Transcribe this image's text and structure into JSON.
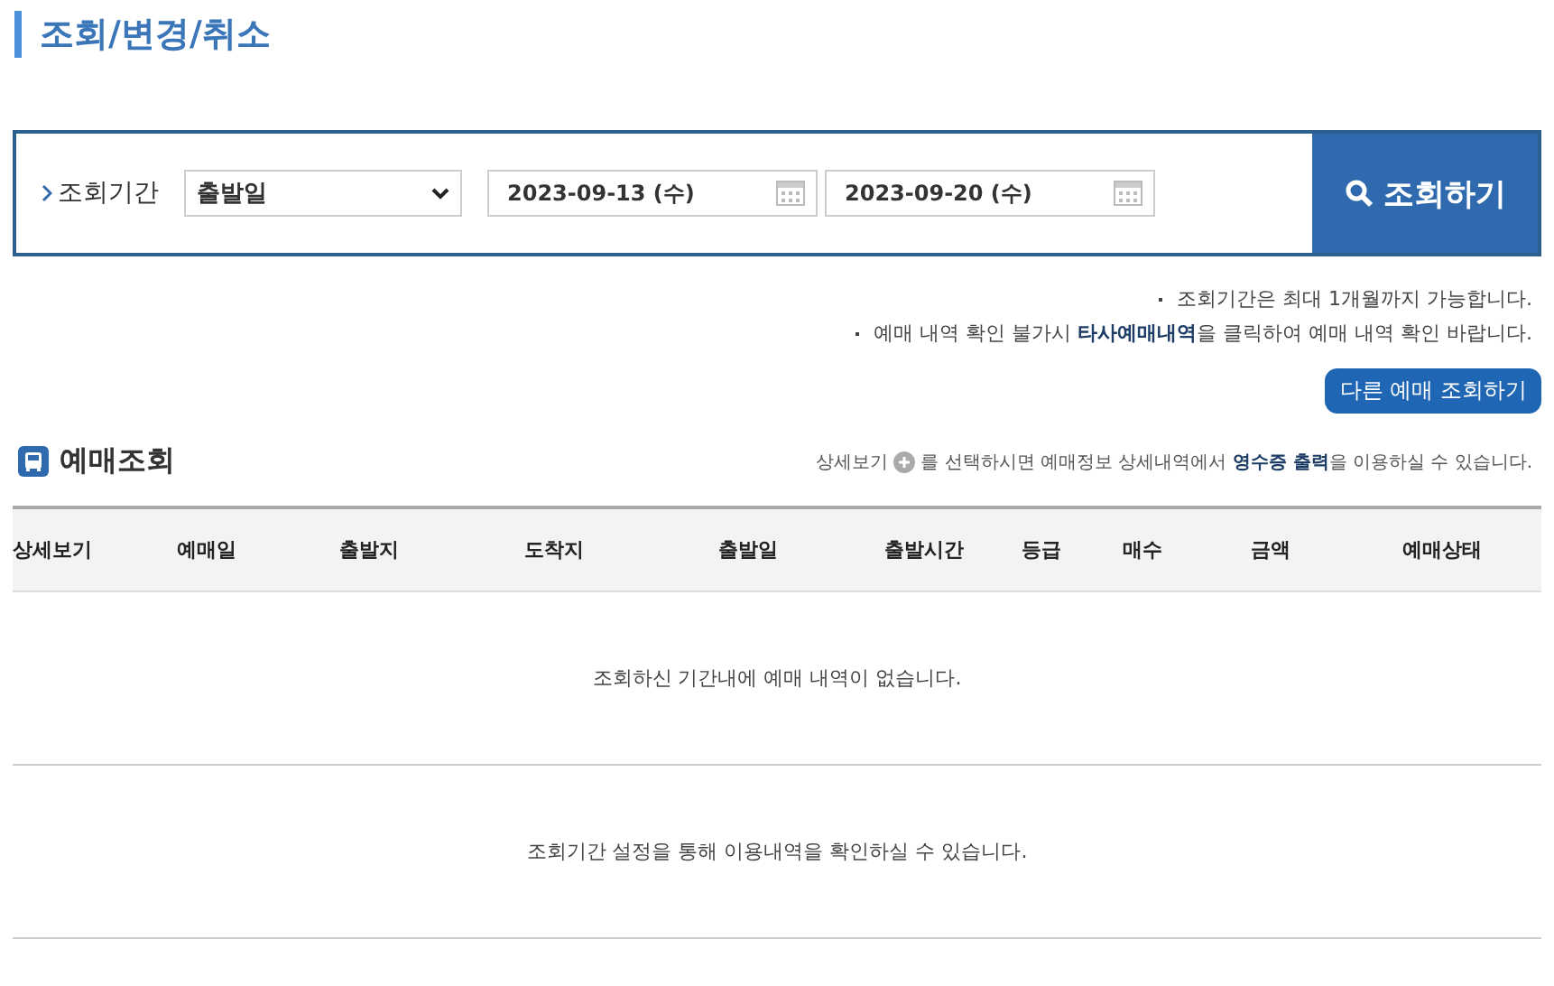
{
  "page_title": "조회/변경/취소",
  "search": {
    "label": "조회기간",
    "date_type": "출발일",
    "start_date": "2023-09-13 (수)",
    "end_date": "2023-09-20 (수)",
    "button": "조회하기"
  },
  "notes": [
    "조회기간은 최대 1개월까지 가능합니다.",
    "예매 내역 확인 불가시 **타사예매내역**을 클릭하여 예매 내역 확인 바랍니다."
  ],
  "other_button": "다른 예매 조회하기",
  "section": {
    "title": "예매조회",
    "help_before": "상세보기",
    "help_after": "를 선택하시면 예매정보 상세내역에서 **영수증 출력**을 이용하실 수 있습니다."
  },
  "table": {
    "columns": [
      "상세보기",
      "예매일",
      "출발지",
      "도착지",
      "출발일",
      "출발시간",
      "등급",
      "매수",
      "금액",
      "예매상태"
    ],
    "messages": [
      "조회하신 기간내에 예매 내역이 없습니다.",
      "조회기간 설정을 통해 이용내역을 확인하실 수 있습니다."
    ]
  }
}
